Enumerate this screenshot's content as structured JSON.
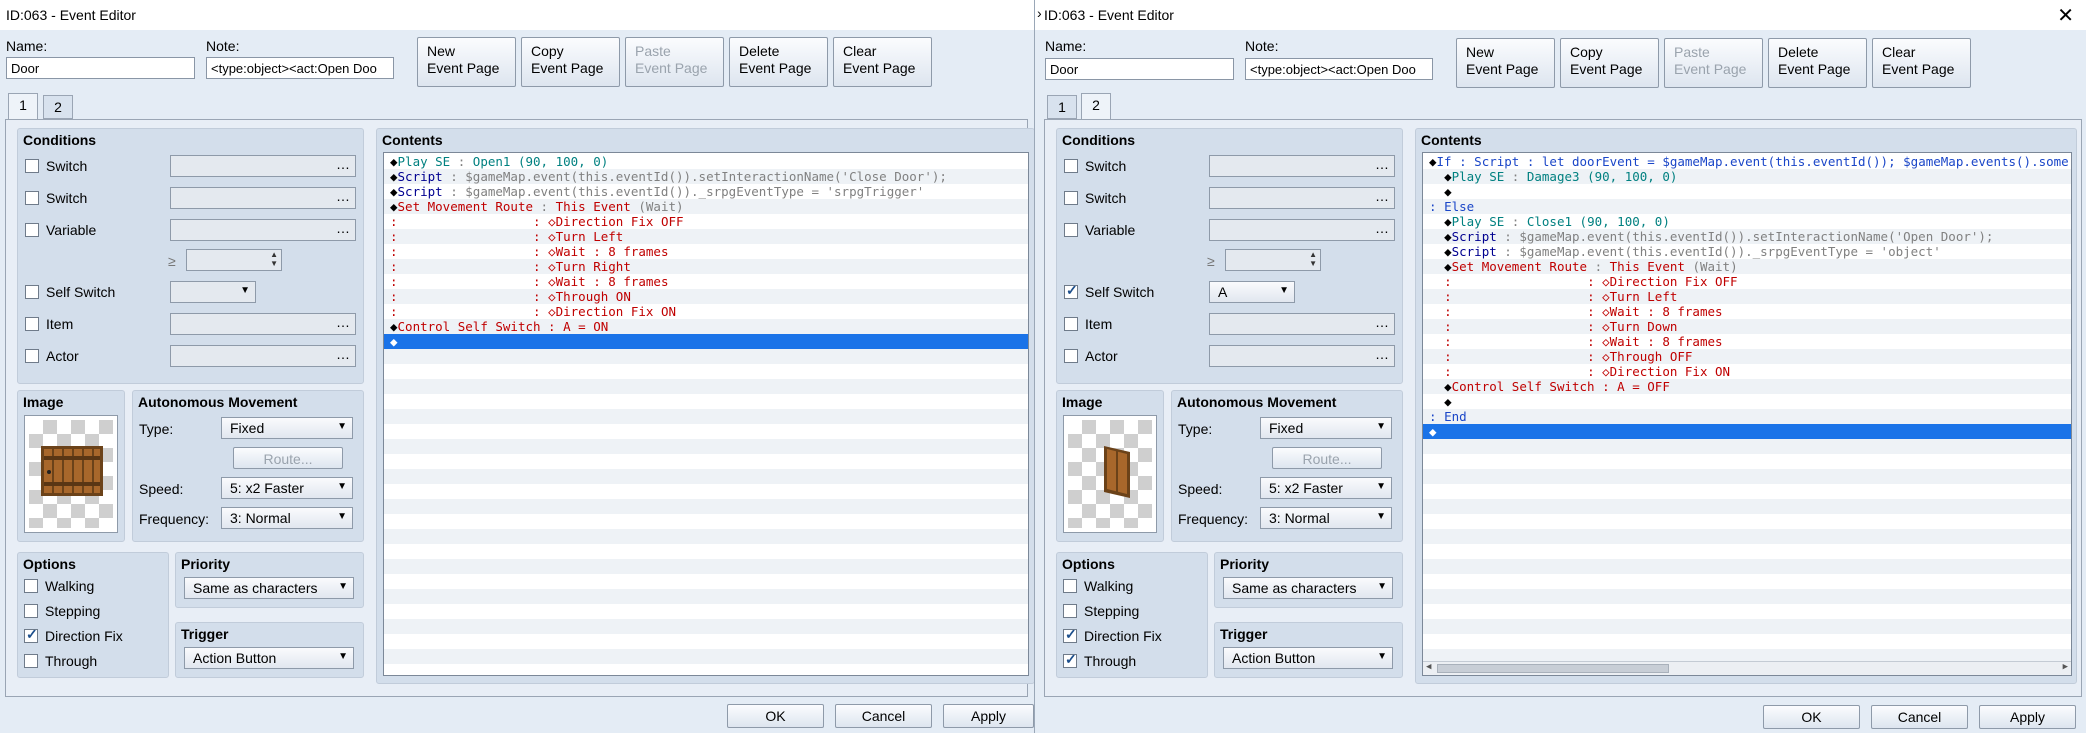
{
  "left": {
    "title": "ID:063 - Event Editor",
    "name_label": "Name:",
    "name_value": "Door",
    "note_label": "Note:",
    "note_value": "<type:object><act:Open Doo",
    "buttons": {
      "new_l1": "New",
      "new_l2": "Event Page",
      "copy_l1": "Copy",
      "copy_l2": "Event Page",
      "paste_l1": "Paste",
      "paste_l2": "Event Page",
      "delete_l1": "Delete",
      "delete_l2": "Event Page",
      "clear_l1": "Clear",
      "clear_l2": "Event Page"
    },
    "tabs": [
      "1",
      "2"
    ],
    "active_tab": 0,
    "conditions": {
      "title": "Conditions",
      "switch1": "Switch",
      "switch2": "Switch",
      "variable": "Variable",
      "gte": "≥",
      "self_switch": "Self Switch",
      "self_switch_value": "",
      "item": "Item",
      "actor": "Actor",
      "checked": {
        "self_switch": false
      }
    },
    "image_title": "Image",
    "autonomous": {
      "title": "Autonomous Movement",
      "type_label": "Type:",
      "type_value": "Fixed",
      "route_button": "Route...",
      "speed_label": "Speed:",
      "speed_value": "5: x2 Faster",
      "freq_label": "Frequency:",
      "freq_value": "3: Normal"
    },
    "options": {
      "title": "Options",
      "walking": "Walking",
      "stepping": "Stepping",
      "direction_fix": "Direction Fix",
      "through": "Through",
      "checked": {
        "walking": false,
        "stepping": false,
        "direction_fix": true,
        "through": false
      }
    },
    "priority": {
      "title": "Priority",
      "value": "Same as characters"
    },
    "trigger": {
      "title": "Trigger",
      "value": "Action Button"
    },
    "contents_title": "Contents",
    "ok": "OK",
    "cancel": "Cancel",
    "apply": "Apply",
    "lines": [
      {
        "i": "",
        "p": [
          [
            "◆",
            ""
          ],
          [
            "Play SE",
            "teal"
          ],
          [
            " : ",
            "gray"
          ],
          [
            "Open1 (90, 100, 0)",
            "teal"
          ]
        ]
      },
      {
        "i": "",
        "p": [
          [
            "◆",
            ""
          ],
          [
            "Script",
            "navy"
          ],
          [
            " : ",
            "gray"
          ],
          [
            "$gameMap.event(this.eventId()).setInteractionName('Close Door');",
            "gray"
          ]
        ]
      },
      {
        "i": "",
        "p": [
          [
            "◆",
            ""
          ],
          [
            "Script",
            "navy"
          ],
          [
            " : ",
            "gray"
          ],
          [
            "$gameMap.event(this.eventId())._srpgEventType = 'srpgTrigger'",
            "gray"
          ]
        ]
      },
      {
        "i": "",
        "p": [
          [
            "◆",
            ""
          ],
          [
            "Set Movement Route",
            "red"
          ],
          [
            " : ",
            "gray"
          ],
          [
            "This Event ",
            "red"
          ],
          [
            "(Wait)",
            "gray"
          ]
        ]
      },
      {
        "i": "",
        "p": [
          [
            ":",
            "red"
          ],
          [
            "                  ",
            ""
          ],
          [
            ": ",
            "red"
          ],
          [
            "◇Direction Fix OFF",
            "red"
          ]
        ]
      },
      {
        "i": "",
        "p": [
          [
            ":",
            "red"
          ],
          [
            "                  ",
            ""
          ],
          [
            ": ",
            "red"
          ],
          [
            "◇Turn Left",
            "red"
          ]
        ]
      },
      {
        "i": "",
        "p": [
          [
            ":",
            "red"
          ],
          [
            "                  ",
            ""
          ],
          [
            ": ",
            "red"
          ],
          [
            "◇Wait : 8 frames",
            "red"
          ]
        ]
      },
      {
        "i": "",
        "p": [
          [
            ":",
            "red"
          ],
          [
            "                  ",
            ""
          ],
          [
            ": ",
            "red"
          ],
          [
            "◇Turn Right",
            "red"
          ]
        ]
      },
      {
        "i": "",
        "p": [
          [
            ":",
            "red"
          ],
          [
            "                  ",
            ""
          ],
          [
            ": ",
            "red"
          ],
          [
            "◇Wait : 8 frames",
            "red"
          ]
        ]
      },
      {
        "i": "",
        "p": [
          [
            ":",
            "red"
          ],
          [
            "                  ",
            ""
          ],
          [
            ": ",
            "red"
          ],
          [
            "◇Through ON",
            "red"
          ]
        ]
      },
      {
        "i": "",
        "p": [
          [
            ":",
            "red"
          ],
          [
            "                  ",
            ""
          ],
          [
            ": ",
            "red"
          ],
          [
            "◇Direction Fix ON",
            "red"
          ]
        ]
      },
      {
        "i": "",
        "p": [
          [
            "◆",
            ""
          ],
          [
            "Control Self Switch",
            "red"
          ],
          [
            " : ",
            "red"
          ],
          [
            "A = ON",
            "red"
          ]
        ]
      },
      {
        "i": "",
        "p": [
          [
            "◆",
            ""
          ]
        ],
        "sel": true
      }
    ]
  },
  "right": {
    "title": "ID:063 - Event Editor",
    "name_label": "Name:",
    "name_value": "Door",
    "note_label": "Note:",
    "note_value": "<type:object><act:Open Doo",
    "buttons": {
      "new_l1": "New",
      "new_l2": "Event Page",
      "copy_l1": "Copy",
      "copy_l2": "Event Page",
      "paste_l1": "Paste",
      "paste_l2": "Event Page",
      "delete_l1": "Delete",
      "delete_l2": "Event Page",
      "clear_l1": "Clear",
      "clear_l2": "Event Page"
    },
    "tabs": [
      "1",
      "2"
    ],
    "active_tab": 1,
    "conditions": {
      "title": "Conditions",
      "switch1": "Switch",
      "switch2": "Switch",
      "variable": "Variable",
      "gte": "≥",
      "self_switch": "Self Switch",
      "self_switch_value": "A",
      "item": "Item",
      "actor": "Actor",
      "checked": {
        "self_switch": true
      }
    },
    "image_title": "Image",
    "autonomous": {
      "title": "Autonomous Movement",
      "type_label": "Type:",
      "type_value": "Fixed",
      "route_button": "Route...",
      "speed_label": "Speed:",
      "speed_value": "5: x2 Faster",
      "freq_label": "Frequency:",
      "freq_value": "3: Normal"
    },
    "options": {
      "title": "Options",
      "walking": "Walking",
      "stepping": "Stepping",
      "direction_fix": "Direction Fix",
      "through": "Through",
      "checked": {
        "walking": false,
        "stepping": false,
        "direction_fix": true,
        "through": true
      }
    },
    "priority": {
      "title": "Priority",
      "value": "Same as characters"
    },
    "trigger": {
      "title": "Trigger",
      "value": "Action Button"
    },
    "contents_title": "Contents",
    "ok": "OK",
    "cancel": "Cancel",
    "apply": "Apply",
    "lines": [
      {
        "i": "",
        "p": [
          [
            "◆",
            ""
          ],
          [
            "If",
            "blue"
          ],
          [
            " : ",
            "blue"
          ],
          [
            "Script",
            "blue"
          ],
          [
            " : ",
            "blue"
          ],
          [
            "let doorEvent = $gameMap.event(this.eventId()); $gameMap.events().some(func",
            "blue"
          ]
        ]
      },
      {
        "i": "  ",
        "p": [
          [
            "◆",
            ""
          ],
          [
            "Play SE",
            "teal"
          ],
          [
            " : ",
            "gray"
          ],
          [
            "Damage3 (90, 100, 0)",
            "teal"
          ]
        ]
      },
      {
        "i": "  ",
        "p": [
          [
            "◆",
            ""
          ]
        ]
      },
      {
        "i": "",
        "p": [
          [
            ": ",
            "blue"
          ],
          [
            "Else",
            "blue"
          ]
        ]
      },
      {
        "i": "  ",
        "p": [
          [
            "◆",
            ""
          ],
          [
            "Play SE",
            "teal"
          ],
          [
            " : ",
            "gray"
          ],
          [
            "Close1 (90, 100, 0)",
            "teal"
          ]
        ]
      },
      {
        "i": "  ",
        "p": [
          [
            "◆",
            ""
          ],
          [
            "Script",
            "navy"
          ],
          [
            " : ",
            "gray"
          ],
          [
            "$gameMap.event(this.eventId()).setInteractionName('Open Door');",
            "gray"
          ]
        ]
      },
      {
        "i": "  ",
        "p": [
          [
            "◆",
            ""
          ],
          [
            "Script",
            "navy"
          ],
          [
            " : ",
            "gray"
          ],
          [
            "$gameMap.event(this.eventId())._srpgEventType = 'object'",
            "gray"
          ]
        ]
      },
      {
        "i": "  ",
        "p": [
          [
            "◆",
            ""
          ],
          [
            "Set Movement Route",
            "red"
          ],
          [
            " : ",
            "gray"
          ],
          [
            "This Event ",
            "red"
          ],
          [
            "(Wait)",
            "gray"
          ]
        ]
      },
      {
        "i": "  ",
        "p": [
          [
            ":",
            "red"
          ],
          [
            "                  ",
            ""
          ],
          [
            ": ",
            "red"
          ],
          [
            "◇Direction Fix OFF",
            "red"
          ]
        ]
      },
      {
        "i": "  ",
        "p": [
          [
            ":",
            "red"
          ],
          [
            "                  ",
            ""
          ],
          [
            ": ",
            "red"
          ],
          [
            "◇Turn Left",
            "red"
          ]
        ]
      },
      {
        "i": "  ",
        "p": [
          [
            ":",
            "red"
          ],
          [
            "                  ",
            ""
          ],
          [
            ": ",
            "red"
          ],
          [
            "◇Wait : 8 frames",
            "red"
          ]
        ]
      },
      {
        "i": "  ",
        "p": [
          [
            ":",
            "red"
          ],
          [
            "                  ",
            ""
          ],
          [
            ": ",
            "red"
          ],
          [
            "◇Turn Down",
            "red"
          ]
        ]
      },
      {
        "i": "  ",
        "p": [
          [
            ":",
            "red"
          ],
          [
            "                  ",
            ""
          ],
          [
            ": ",
            "red"
          ],
          [
            "◇Wait : 8 frames",
            "red"
          ]
        ]
      },
      {
        "i": "  ",
        "p": [
          [
            ":",
            "red"
          ],
          [
            "                  ",
            ""
          ],
          [
            ": ",
            "red"
          ],
          [
            "◇Through OFF",
            "red"
          ]
        ]
      },
      {
        "i": "  ",
        "p": [
          [
            ":",
            "red"
          ],
          [
            "                  ",
            ""
          ],
          [
            ": ",
            "red"
          ],
          [
            "◇Direction Fix ON",
            "red"
          ]
        ]
      },
      {
        "i": "  ",
        "p": [
          [
            "◆",
            ""
          ],
          [
            "Control Self Switch",
            "red"
          ],
          [
            " : ",
            "red"
          ],
          [
            "A = OFF",
            "red"
          ]
        ]
      },
      {
        "i": "  ",
        "p": [
          [
            "◆",
            ""
          ]
        ]
      },
      {
        "i": "",
        "p": [
          [
            ": ",
            "blue"
          ],
          [
            "End",
            "blue"
          ]
        ]
      },
      {
        "i": "",
        "p": [
          [
            "◆",
            ""
          ]
        ],
        "sel": true
      }
    ]
  }
}
